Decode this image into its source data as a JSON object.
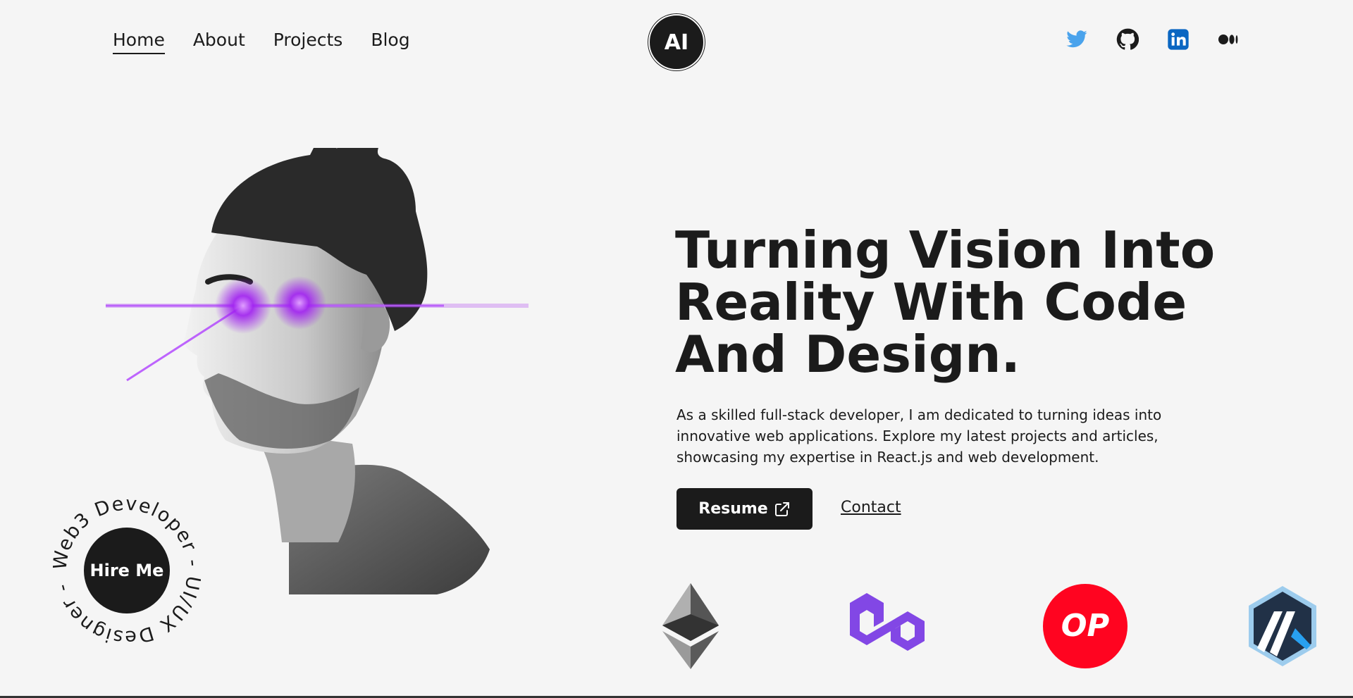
{
  "nav": {
    "links": [
      {
        "label": "Home",
        "active": true
      },
      {
        "label": "About",
        "active": false
      },
      {
        "label": "Projects",
        "active": false
      },
      {
        "label": "Blog",
        "active": false
      }
    ],
    "logo_text": "AI",
    "socials": [
      "twitter-icon",
      "github-icon",
      "linkedin-icon",
      "medium-icon"
    ]
  },
  "hero": {
    "title_line1": "Turning Vision Into",
    "title_line2": "Reality With Code",
    "title_line3": "And Design.",
    "description": "As a skilled full-stack developer, I am dedicated to turning ideas into innovative web applications. Explore my latest projects and articles, showcasing my expertise in React.js and web development.",
    "resume_label": "Resume",
    "contact_label": "Contact"
  },
  "hire": {
    "button_label": "Hire Me",
    "ring_text": "Web3 Developer - UI/UX Designer - "
  },
  "crypto": {
    "op_text": "OP"
  },
  "colors": {
    "dark": "#1b1b1b",
    "background": "#f5f5f5",
    "twitter": "#4aa3ec",
    "linkedin": "#0a66c2",
    "polygon": "#8247e5",
    "optimism": "#ff0420",
    "arbitrum": "#213147",
    "laser": "#a020f0"
  }
}
